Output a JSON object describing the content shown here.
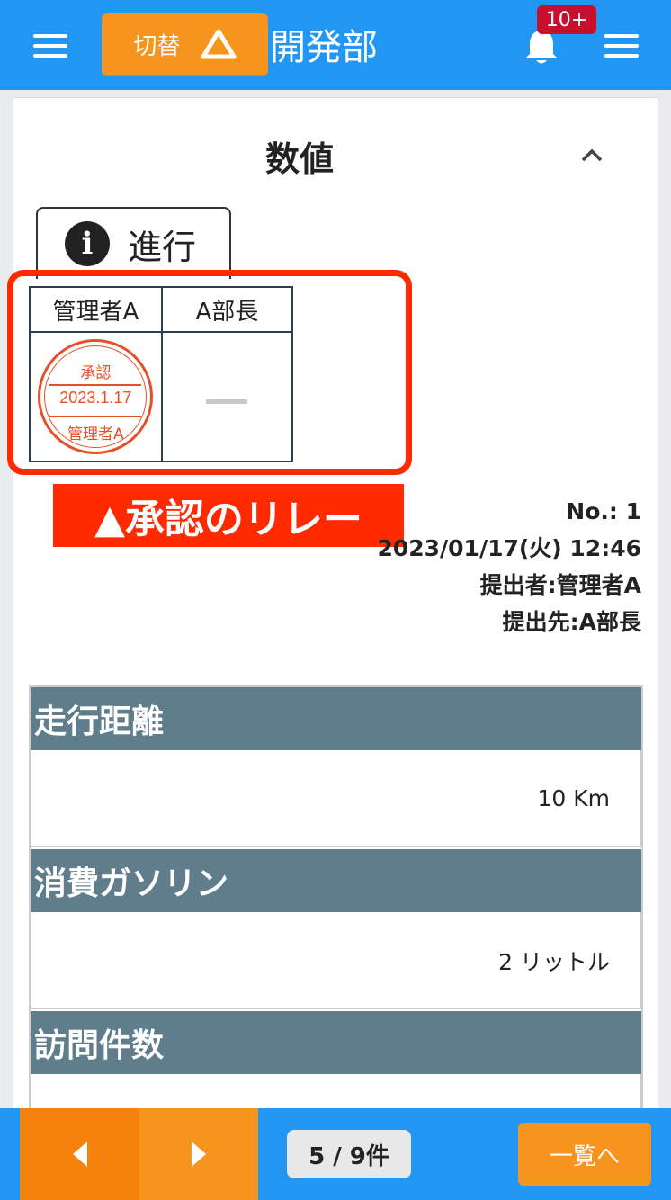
{
  "header": {
    "menu_icon": "hamburger-icon",
    "switch_label": "切替",
    "switch_icon": "triangle-icon",
    "department": "開発部",
    "notification_badge": "10+",
    "bell_icon": "bell-icon",
    "right_menu_icon": "hamburger-icon",
    "colors": {
      "bar": "#2196f3",
      "accent": "#f7941d",
      "badge": "#c8102e"
    }
  },
  "section": {
    "title": "数値",
    "collapse_icon": "chevron-up-icon"
  },
  "status": {
    "icon": "info-icon",
    "label": "進行"
  },
  "approval": {
    "columns": [
      "管理者A",
      "A部長"
    ],
    "seal": {
      "line1": "承認",
      "date": "2023.1.17",
      "name": "管理者A",
      "color": "#e5502b"
    },
    "pending_mark": "—"
  },
  "annotation": {
    "text": "▲承認のリレー",
    "color": "#ff2a00"
  },
  "meta": {
    "number": "No.: 1",
    "datetime": "2023/01/17(火) 12:46",
    "submitter": "提出者:管理者A",
    "recipient": "提出先:A部長"
  },
  "fields": [
    {
      "label": "走行距離",
      "value": "10 Km"
    },
    {
      "label": "消費ガソリン",
      "value": "2 リットル"
    },
    {
      "label": "訪問件数",
      "value": ""
    }
  ],
  "footer": {
    "prev_icon": "arrow-left-icon",
    "next_icon": "arrow-right-icon",
    "page_count": "5 / 9件",
    "list_label": "一覧へ"
  }
}
